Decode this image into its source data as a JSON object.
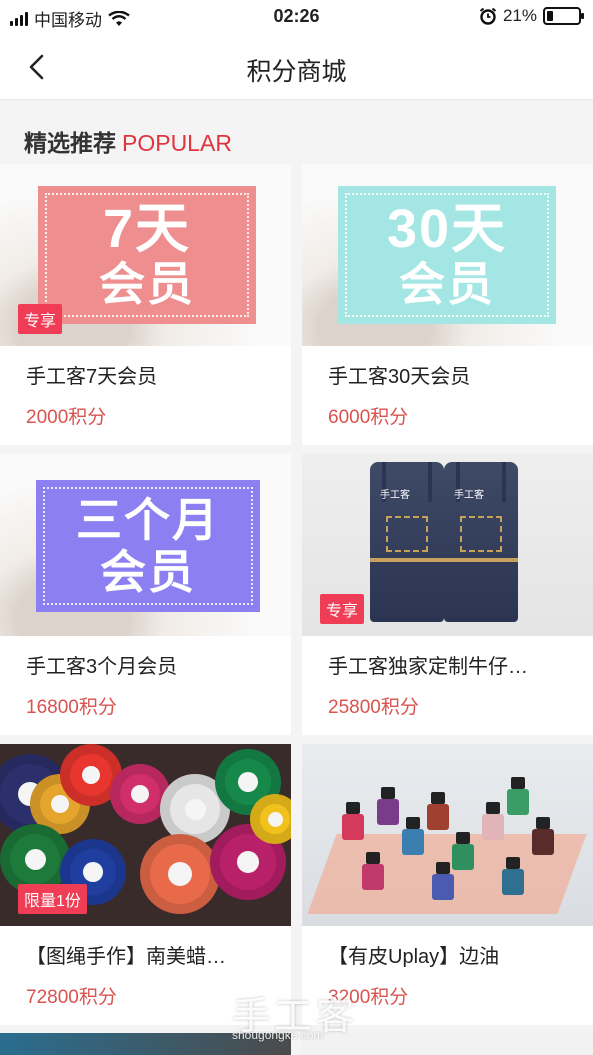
{
  "status_bar": {
    "carrier": "中国移动",
    "time": "02:26",
    "battery_percent": "21%",
    "battery_level": 0.21,
    "icons": [
      "signal-icon",
      "wifi-icon",
      "alarm-icon",
      "battery-icon"
    ]
  },
  "nav": {
    "title": "积分商城",
    "back_icon": "chevron-left-icon"
  },
  "section": {
    "title": "精选推荐",
    "subtitle": "POPULAR"
  },
  "products": [
    {
      "name": "手工客7天会员",
      "price": "2000积分",
      "badge": "专享",
      "image": {
        "kind": "promo",
        "line1": "7天",
        "line2": "会员",
        "color": "#ee8e8f"
      }
    },
    {
      "name": "手工客30天会员",
      "price": "6000积分",
      "image": {
        "kind": "promo",
        "line1": "30天",
        "line2": "会员",
        "color": "#a3e6e4"
      }
    },
    {
      "name": "手工客3个月会员",
      "price": "16800积分",
      "image": {
        "kind": "promo",
        "line1": "三个月",
        "line2": "会员",
        "color": "#8c7ff2"
      }
    },
    {
      "name": "手工客独家定制牛仔…",
      "price": "25800积分",
      "badge": "专享",
      "image": {
        "kind": "apron",
        "apron_label": "手工客"
      }
    },
    {
      "name": "【图绳手作】南美蜡…",
      "price": "72800积分",
      "badge": "限量1份",
      "image": {
        "kind": "threads"
      }
    },
    {
      "name": "【有皮Uplay】边油",
      "price": "3200积分",
      "image": {
        "kind": "ink"
      }
    }
  ],
  "watermark": {
    "text": "手工客",
    "sub": "shougongke.com"
  },
  "colors": {
    "accent_red": "#e0353f",
    "price_red": "#d9534f",
    "badge_red": "#ee3d55",
    "background": "#f4f4f4"
  }
}
